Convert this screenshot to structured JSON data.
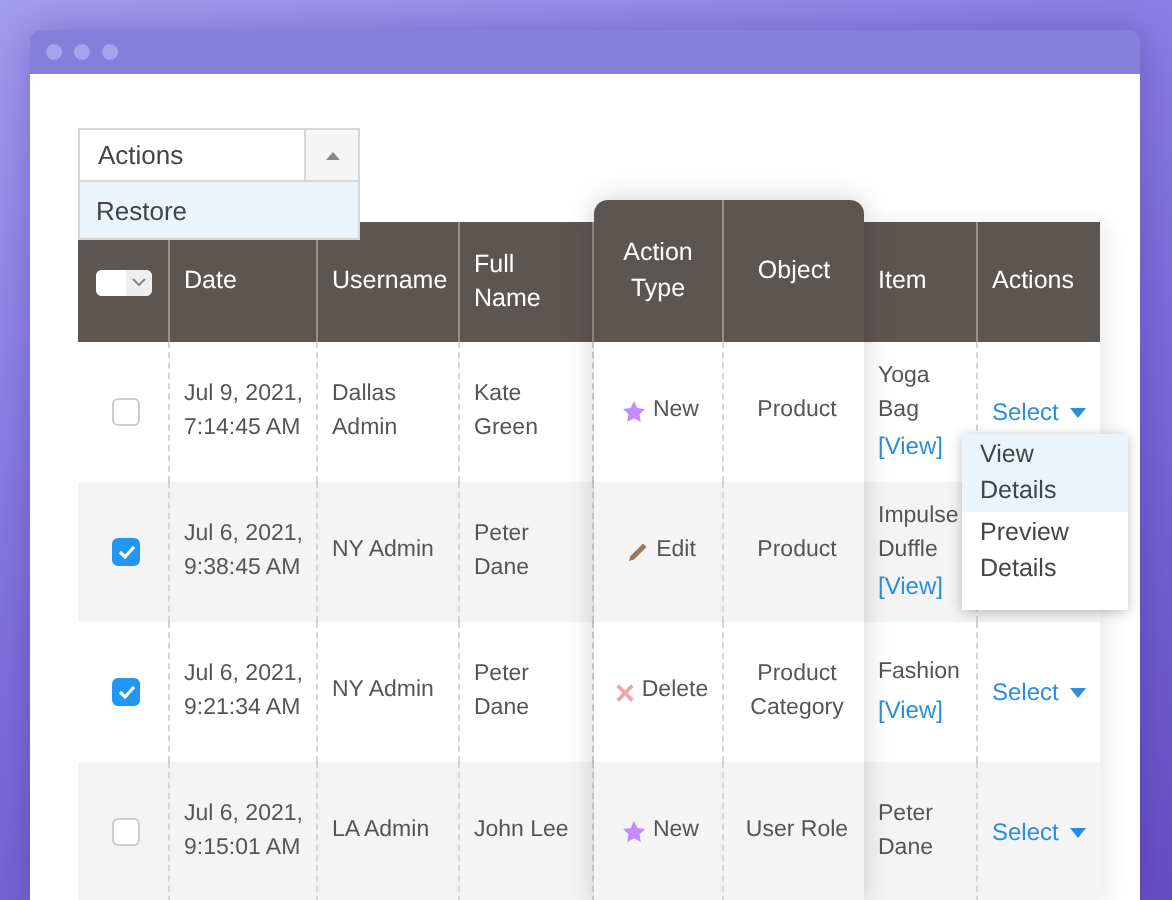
{
  "actions_dropdown": {
    "label": "Actions",
    "expanded": true,
    "options": [
      {
        "label": "Restore",
        "selected": true
      }
    ]
  },
  "table": {
    "select_all": {
      "checked": false
    },
    "columns": [
      "Date",
      "Username",
      "Full Name",
      "Action Type",
      "Object",
      "Item",
      "Actions"
    ],
    "rows": [
      {
        "checked": false,
        "date": "Jul 9, 2021, 7:14:45 AM",
        "username": "Dallas Admin",
        "full_name": "Kate Green",
        "kind": "new",
        "action": "New",
        "object": "Product",
        "item": "Yoga Bag",
        "item_link": "[View]",
        "select": "Select",
        "menu": [
          {
            "label": "View Details",
            "selected": true
          },
          {
            "label": "Preview Details",
            "selected": false
          }
        ]
      },
      {
        "checked": true,
        "date": "Jul 6, 2021, 9:38:45 AM",
        "username": "NY Admin",
        "full_name": "Peter Dane",
        "kind": "edit",
        "action": "Edit",
        "object": "Product",
        "item": "Impulse Duffle",
        "item_link": "[View]"
      },
      {
        "checked": true,
        "date": "Jul 6, 2021, 9:21:34 AM",
        "username": "NY Admin",
        "full_name": "Peter Dane",
        "kind": "delete",
        "action": "Delete",
        "object": "Product Category",
        "item": "Fashion",
        "item_link": "[View]",
        "select": "Select"
      },
      {
        "checked": false,
        "date": "Jul 6, 2021, 9:15:01 AM",
        "username": "LA Admin",
        "full_name": "John Lee",
        "kind": "new",
        "action": "New",
        "object": "User Role",
        "item": "Peter Dane",
        "select": "Select"
      }
    ]
  }
}
